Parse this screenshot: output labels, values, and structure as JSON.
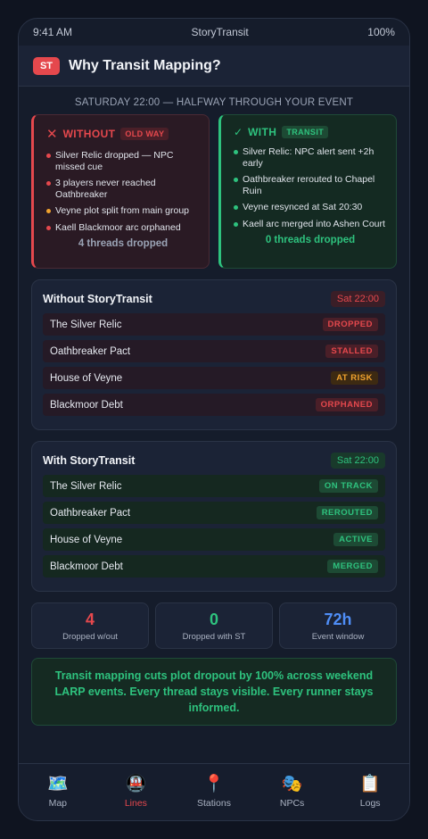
{
  "status_bar": {
    "time": "9:41 AM",
    "app_name": "StoryTransit",
    "battery": "100%"
  },
  "header": {
    "logo": "ST",
    "title": "Why Transit Mapping?"
  },
  "subtitle": "SATURDAY 22:00 — HALFWAY THROUGH YOUR EVENT",
  "without_card": {
    "icon": "cross-icon",
    "title": "WITHOUT",
    "tag": "OLD WAY",
    "items": [
      {
        "text": "Silver Relic dropped — NPC missed cue",
        "color": "#e5484d"
      },
      {
        "text": "3 players never reached Oathbreaker",
        "color": "#e5484d"
      },
      {
        "text": "Veyne plot split from main group",
        "color": "#f0a22e"
      },
      {
        "text": "Kaell Blackmoor arc orphaned",
        "color": "#e5484d"
      }
    ],
    "summary": "4 threads dropped"
  },
  "with_card": {
    "icon": "check-icon",
    "title": "WITH",
    "tag": "TRANSIT",
    "items": [
      {
        "text": "Silver Relic: NPC alert sent +2h early",
        "color": "#2ec27e"
      },
      {
        "text": "Oathbreaker rerouted to Chapel Ruin",
        "color": "#2ec27e"
      },
      {
        "text": "Veyne resynced at Sat 20:30",
        "color": "#2ec27e"
      },
      {
        "text": "Kaell arc merged into Ashen Court",
        "color": "#2ec27e"
      }
    ],
    "summary": "0 threads dropped"
  },
  "without_panel": {
    "title": "Without StoryTransit",
    "time": "Sat 22:00",
    "rows": [
      {
        "name": "The Silver Relic",
        "status": "DROPPED",
        "tone": "red"
      },
      {
        "name": "Oathbreaker Pact",
        "status": "STALLED",
        "tone": "red"
      },
      {
        "name": "House of Veyne",
        "status": "AT RISK",
        "tone": "amber"
      },
      {
        "name": "Blackmoor Debt",
        "status": "ORPHANED",
        "tone": "red"
      }
    ]
  },
  "with_panel": {
    "title": "With StoryTransit",
    "time": "Sat 22:00",
    "rows": [
      {
        "name": "The Silver Relic",
        "status": "ON TRACK",
        "tone": "green"
      },
      {
        "name": "Oathbreaker Pact",
        "status": "REROUTED",
        "tone": "green"
      },
      {
        "name": "House of Veyne",
        "status": "ACTIVE",
        "tone": "green"
      },
      {
        "name": "Blackmoor Debt",
        "status": "MERGED",
        "tone": "green"
      }
    ]
  },
  "stats": [
    {
      "value": "4",
      "label": "Dropped w/out",
      "color": "#e5484d"
    },
    {
      "value": "0",
      "label": "Dropped with ST",
      "color": "#2ec27e"
    },
    {
      "value": "72h",
      "label": "Event window",
      "color": "#4f8ef7"
    }
  ],
  "callout": "Transit mapping cuts plot dropout by 100% across weekend LARP events. Every thread stays visible. Every runner stays informed.",
  "tabs": [
    {
      "label": "Map",
      "icon": "map-icon",
      "glyph": "🗺️",
      "active": false
    },
    {
      "label": "Lines",
      "icon": "train-icon",
      "glyph": "🚇",
      "active": true
    },
    {
      "label": "Stations",
      "icon": "pin-icon",
      "glyph": "📍",
      "active": false
    },
    {
      "label": "NPCs",
      "icon": "masks-icon",
      "glyph": "🎭",
      "active": false
    },
    {
      "label": "Logs",
      "icon": "clipboard-icon",
      "glyph": "📋",
      "active": false
    }
  ]
}
